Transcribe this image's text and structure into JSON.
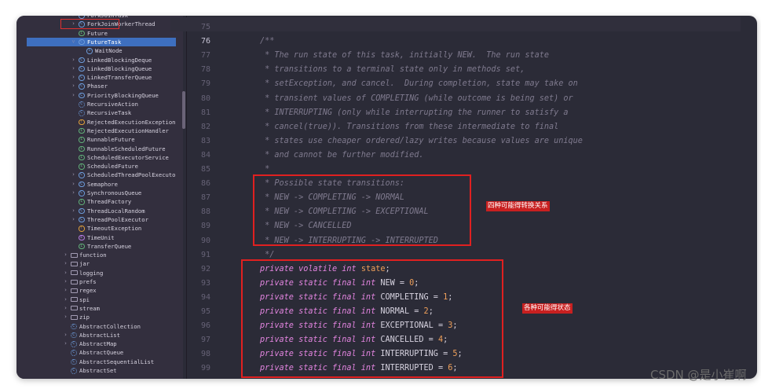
{
  "sidebar": {
    "items": [
      {
        "label": "ForkJoinTask",
        "icon": "class-icon",
        "indent": 3,
        "expandable": true
      },
      {
        "label": "ForkJoinWorkerThread",
        "icon": "class-icon",
        "indent": 3,
        "expandable": true
      },
      {
        "label": "Future",
        "icon": "interface-icon",
        "indent": 3,
        "expandable": false
      },
      {
        "label": "FutureTask",
        "icon": "class-icon",
        "indent": 3,
        "expandable": true,
        "expanded": true,
        "selected": true
      },
      {
        "label": "WaitNode",
        "icon": "static-class-icon",
        "indent": 4,
        "expandable": false
      },
      {
        "label": "LinkedBlockingDeque",
        "icon": "class-icon",
        "indent": 3,
        "expandable": true
      },
      {
        "label": "LinkedBlockingQueue",
        "icon": "class-icon",
        "indent": 3,
        "expandable": true
      },
      {
        "label": "LinkedTransferQueue",
        "icon": "class-icon",
        "indent": 3,
        "expandable": true
      },
      {
        "label": "Phaser",
        "icon": "class-icon",
        "indent": 3,
        "expandable": true
      },
      {
        "label": "PriorityBlockingQueue",
        "icon": "class-icon",
        "indent": 3,
        "expandable": true
      },
      {
        "label": "RecursiveAction",
        "icon": "abstract-class-icon",
        "indent": 3,
        "expandable": false
      },
      {
        "label": "RecursiveTask",
        "icon": "abstract-class-icon",
        "indent": 3,
        "expandable": false
      },
      {
        "label": "RejectedExecutionException",
        "icon": "exception-icon",
        "indent": 3,
        "expandable": false
      },
      {
        "label": "RejectedExecutionHandler",
        "icon": "interface-icon",
        "indent": 3,
        "expandable": false
      },
      {
        "label": "RunnableFuture",
        "icon": "interface-icon",
        "indent": 3,
        "expandable": false
      },
      {
        "label": "RunnableScheduledFuture",
        "icon": "interface-icon",
        "indent": 3,
        "expandable": false
      },
      {
        "label": "ScheduledExecutorService",
        "icon": "interface-icon",
        "indent": 3,
        "expandable": false
      },
      {
        "label": "ScheduledFuture",
        "icon": "interface-icon",
        "indent": 3,
        "expandable": false
      },
      {
        "label": "ScheduledThreadPoolExecuto",
        "icon": "class-icon",
        "indent": 3,
        "expandable": true
      },
      {
        "label": "Semaphore",
        "icon": "class-icon",
        "indent": 3,
        "expandable": true
      },
      {
        "label": "SynchronousQueue",
        "icon": "class-icon",
        "indent": 3,
        "expandable": true
      },
      {
        "label": "ThreadFactory",
        "icon": "interface-icon",
        "indent": 3,
        "expandable": false
      },
      {
        "label": "ThreadLocalRandom",
        "icon": "class-icon",
        "indent": 3,
        "expandable": true
      },
      {
        "label": "ThreadPoolExecutor",
        "icon": "class-icon",
        "indent": 3,
        "expandable": true
      },
      {
        "label": "TimeoutException",
        "icon": "exception-icon",
        "indent": 3,
        "expandable": false
      },
      {
        "label": "TimeUnit",
        "icon": "enum-icon",
        "indent": 3,
        "expandable": false
      },
      {
        "label": "TransferQueue",
        "icon": "interface-icon",
        "indent": 3,
        "expandable": false
      },
      {
        "label": "function",
        "icon": "folder-icon",
        "indent": 2,
        "expandable": true
      },
      {
        "label": "jar",
        "icon": "folder-icon",
        "indent": 2,
        "expandable": true
      },
      {
        "label": "logging",
        "icon": "folder-icon",
        "indent": 2,
        "expandable": true
      },
      {
        "label": "prefs",
        "icon": "folder-icon",
        "indent": 2,
        "expandable": true
      },
      {
        "label": "regex",
        "icon": "folder-icon",
        "indent": 2,
        "expandable": true
      },
      {
        "label": "spi",
        "icon": "folder-icon",
        "indent": 2,
        "expandable": true
      },
      {
        "label": "stream",
        "icon": "folder-icon",
        "indent": 2,
        "expandable": true
      },
      {
        "label": "zip",
        "icon": "folder-icon",
        "indent": 2,
        "expandable": true
      },
      {
        "label": "AbstractCollection",
        "icon": "abstract-class-icon",
        "indent": 2,
        "expandable": false
      },
      {
        "label": "AbstractList",
        "icon": "abstract-class-icon",
        "indent": 2,
        "expandable": true
      },
      {
        "label": "AbstractMap",
        "icon": "abstract-class-icon",
        "indent": 2,
        "expandable": true
      },
      {
        "label": "AbstractQueue",
        "icon": "abstract-class-icon",
        "indent": 2,
        "expandable": false
      },
      {
        "label": "AbstractSequentialList",
        "icon": "abstract-class-icon",
        "indent": 2,
        "expandable": false
      },
      {
        "label": "AbstractSet",
        "icon": "abstract-class-icon",
        "indent": 2,
        "expandable": false
      }
    ]
  },
  "editor": {
    "current_line": "76",
    "lines": [
      {
        "num": "75",
        "tokens": []
      },
      {
        "num": "76",
        "tokens": [
          {
            "t": "/**",
            "c": "comment"
          }
        ]
      },
      {
        "num": "77",
        "tokens": [
          {
            "t": " * The run state of this task, initially NEW.  The run state",
            "c": "comment"
          }
        ]
      },
      {
        "num": "78",
        "tokens": [
          {
            "t": " * transitions to a terminal state only in methods set,",
            "c": "comment"
          }
        ]
      },
      {
        "num": "79",
        "tokens": [
          {
            "t": " * setException, and cancel.  During completion, state may take on",
            "c": "comment"
          }
        ]
      },
      {
        "num": "80",
        "tokens": [
          {
            "t": " * transient values of COMPLETING (while outcome is being set) or",
            "c": "comment"
          }
        ]
      },
      {
        "num": "81",
        "tokens": [
          {
            "t": " * INTERRUPTING (only while interrupting the runner to satisfy a",
            "c": "comment"
          }
        ]
      },
      {
        "num": "82",
        "tokens": [
          {
            "t": " * cancel(true)). Transitions from these intermediate to final",
            "c": "comment"
          }
        ]
      },
      {
        "num": "83",
        "tokens": [
          {
            "t": " * states use cheaper ordered/lazy writes because values are unique",
            "c": "comment"
          }
        ]
      },
      {
        "num": "84",
        "tokens": [
          {
            "t": " * and cannot be further modified.",
            "c": "comment"
          }
        ]
      },
      {
        "num": "85",
        "tokens": [
          {
            "t": " *",
            "c": "comment"
          }
        ]
      },
      {
        "num": "86",
        "tokens": [
          {
            "t": " * Possible state transitions:",
            "c": "comment"
          }
        ]
      },
      {
        "num": "87",
        "tokens": [
          {
            "t": " * NEW -> COMPLETING -> NORMAL",
            "c": "comment"
          }
        ]
      },
      {
        "num": "88",
        "tokens": [
          {
            "t": " * NEW -> COMPLETING -> EXCEPTIONAL",
            "c": "comment"
          }
        ]
      },
      {
        "num": "89",
        "tokens": [
          {
            "t": " * NEW -> CANCELLED",
            "c": "comment"
          }
        ]
      },
      {
        "num": "90",
        "tokens": [
          {
            "t": " * NEW -> INTERRUPTING -> INTERRUPTED",
            "c": "comment"
          }
        ]
      },
      {
        "num": "91",
        "tokens": [
          {
            "t": " */",
            "c": "comment"
          }
        ]
      },
      {
        "num": "92",
        "tokens": [
          {
            "t": "private volatile int ",
            "c": "kw"
          },
          {
            "t": "state",
            "c": "field"
          },
          {
            "t": ";",
            "c": "punct"
          }
        ]
      },
      {
        "num": "93",
        "tokens": [
          {
            "t": "private static final int ",
            "c": "kw"
          },
          {
            "t": "NEW = ",
            "c": "punct"
          },
          {
            "t": "0",
            "c": "num"
          },
          {
            "t": ";",
            "c": "punct"
          }
        ]
      },
      {
        "num": "94",
        "tokens": [
          {
            "t": "private static final int ",
            "c": "kw"
          },
          {
            "t": "COMPLETING = ",
            "c": "punct"
          },
          {
            "t": "1",
            "c": "num"
          },
          {
            "t": ";",
            "c": "punct"
          }
        ]
      },
      {
        "num": "95",
        "tokens": [
          {
            "t": "private static final int ",
            "c": "kw"
          },
          {
            "t": "NORMAL = ",
            "c": "punct"
          },
          {
            "t": "2",
            "c": "num"
          },
          {
            "t": ";",
            "c": "punct"
          }
        ]
      },
      {
        "num": "96",
        "tokens": [
          {
            "t": "private static final int ",
            "c": "kw"
          },
          {
            "t": "EXCEPTIONAL = ",
            "c": "punct"
          },
          {
            "t": "3",
            "c": "num"
          },
          {
            "t": ";",
            "c": "punct"
          }
        ]
      },
      {
        "num": "97",
        "tokens": [
          {
            "t": "private static final int ",
            "c": "kw"
          },
          {
            "t": "CANCELLED = ",
            "c": "punct"
          },
          {
            "t": "4",
            "c": "num"
          },
          {
            "t": ";",
            "c": "punct"
          }
        ]
      },
      {
        "num": "98",
        "tokens": [
          {
            "t": "private static final int ",
            "c": "kw"
          },
          {
            "t": "INTERRUPTING = ",
            "c": "punct"
          },
          {
            "t": "5",
            "c": "num"
          },
          {
            "t": ";",
            "c": "punct"
          }
        ]
      },
      {
        "num": "99",
        "tokens": [
          {
            "t": "private static final int ",
            "c": "kw"
          },
          {
            "t": "INTERRUPTED = ",
            "c": "punct"
          },
          {
            "t": "6",
            "c": "num"
          },
          {
            "t": ";",
            "c": "punct"
          }
        ]
      }
    ]
  },
  "annotations": {
    "transitions_label": "四种可能得转换关系",
    "states_label": "各种可能得状态"
  },
  "watermark": "CSDN @是小崔啊",
  "colors": {
    "selection": "#3e6fbf",
    "highlight_box": "#e02020",
    "keyword": "#e385e0",
    "comment": "#7f7a8e",
    "number": "#f0a05a"
  }
}
